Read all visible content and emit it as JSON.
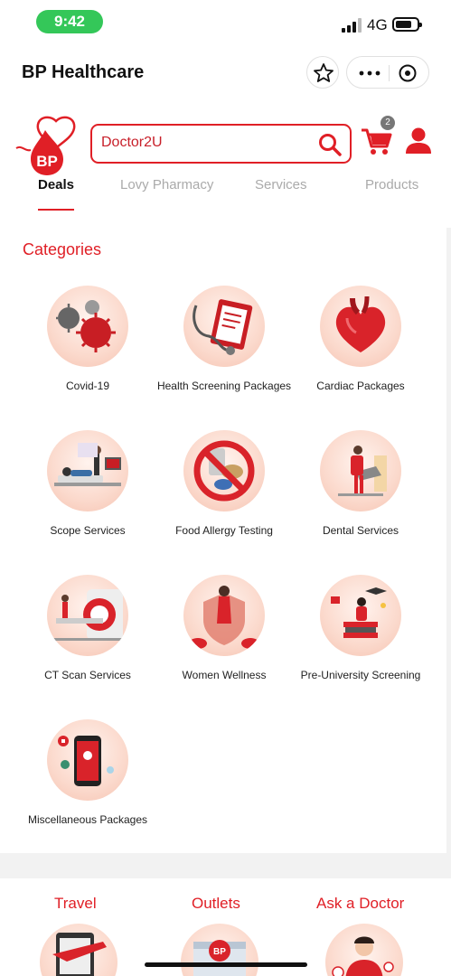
{
  "status": {
    "time": "9:42",
    "network": "4G"
  },
  "header": {
    "title": "BP Healthcare"
  },
  "search": {
    "value": "Doctor2U"
  },
  "cart": {
    "badge": "2"
  },
  "tabs": [
    {
      "label": "Deals",
      "active": true
    },
    {
      "label": "Lovy Pharmacy",
      "active": false
    },
    {
      "label": "Services",
      "active": false
    },
    {
      "label": "Products",
      "active": false
    }
  ],
  "categories": {
    "title": "Categories",
    "items": [
      {
        "label": "Covid-19",
        "icon": "virus-icon"
      },
      {
        "label": "Health Screening Packages",
        "icon": "clipboard-stethoscope-icon"
      },
      {
        "label": "Cardiac Packages",
        "icon": "heart-icon"
      },
      {
        "label": "Scope Services",
        "icon": "hospital-bed-icon"
      },
      {
        "label": "Food Allergy Testing",
        "icon": "no-food-icon"
      },
      {
        "label": "Dental Services",
        "icon": "dental-chair-icon"
      },
      {
        "label": "CT Scan Services",
        "icon": "ct-scanner-icon"
      },
      {
        "label": "Women Wellness",
        "icon": "woman-shield-icon"
      },
      {
        "label": "Pre-University Screening",
        "icon": "student-books-icon"
      },
      {
        "label": "Miscellaneous Packages",
        "icon": "phone-app-icon"
      }
    ]
  },
  "bottom_sections": [
    {
      "label": "Travel",
      "icon": "airplane-passport-icon"
    },
    {
      "label": "Outlets",
      "icon": "bp-building-icon"
    },
    {
      "label": "Ask a Doctor",
      "icon": "doctor-headset-icon"
    }
  ],
  "colors": {
    "brand_red": "#e01f26",
    "status_green": "#34c759"
  }
}
